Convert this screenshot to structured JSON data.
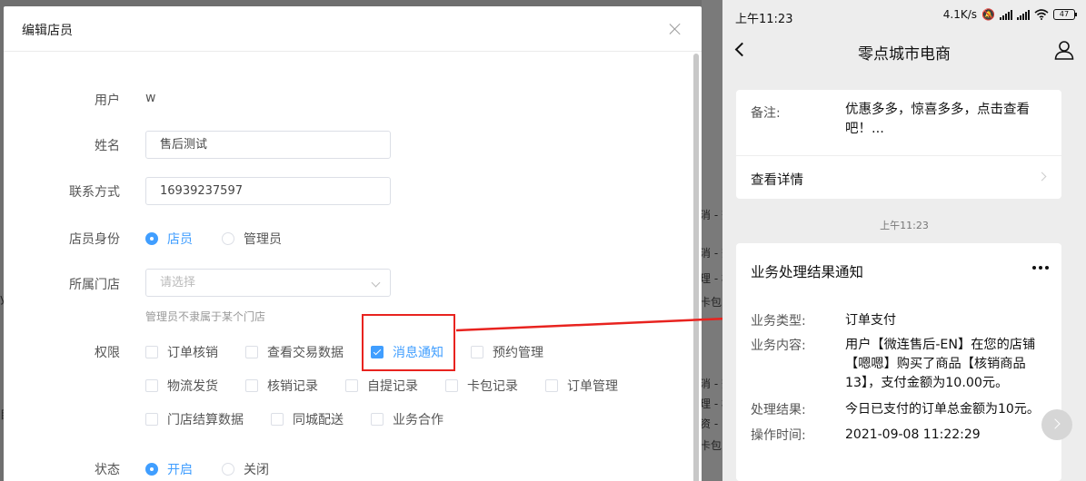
{
  "modal": {
    "title": "编辑店员",
    "fields": {
      "user_label": "用户",
      "user_value": "w",
      "name_label": "姓名",
      "name_value": "售后测试",
      "contact_label": "联系方式",
      "contact_value": "16939237597",
      "role_label": "店员身份",
      "role_options": [
        "店员",
        "管理员"
      ],
      "role_selected": "店员",
      "store_label": "所属门店",
      "store_placeholder": "请选择",
      "store_hint": "管理员不隶属于某个门店",
      "perm_label": "权限",
      "permissions": [
        {
          "label": "订单核销",
          "checked": false
        },
        {
          "label": "查看交易数据",
          "checked": false
        },
        {
          "label": "消息通知",
          "checked": true
        },
        {
          "label": "预约管理",
          "checked": false
        },
        {
          "label": "物流发货",
          "checked": false
        },
        {
          "label": "核销记录",
          "checked": false
        },
        {
          "label": "自提记录",
          "checked": false
        },
        {
          "label": "卡包记录",
          "checked": false
        },
        {
          "label": "订单管理",
          "checked": false
        },
        {
          "label": "门店结算数据",
          "checked": false
        },
        {
          "label": "同城配送",
          "checked": false
        },
        {
          "label": "业务合作",
          "checked": false
        }
      ],
      "status_label": "状态",
      "status_options": [
        "开启",
        "关闭"
      ],
      "status_selected": "开启"
    }
  },
  "background_fragments": [
    "消 - 查",
    "消 - 查",
    "理 - 核",
    "卡包",
    "消 - 查",
    "理 - 核",
    "资 - 门",
    "卡包",
    "y",
    "目"
  ],
  "phone": {
    "status_bar": {
      "time": "上午11:23",
      "speed": "4.1K/s",
      "battery": "47"
    },
    "nav_title": "零点城市电商",
    "card1": {
      "note_label": "备注:",
      "note_text": "优惠多多，惊喜多多，点击查看吧！...",
      "detail_label": "查看详情"
    },
    "timestamp": "上午11:23",
    "card2": {
      "title": "业务处理结果通知",
      "rows": [
        {
          "key": "业务类型:",
          "value": "订单支付"
        },
        {
          "key": "业务内容:",
          "value": "用户【微连售后-EN】在您的店铺【嗯嗯】购买了商品【核销商品13】，支付金额为10.00元。"
        },
        {
          "key": "处理结果:",
          "value": "今日已支付的订单总金额为10元。"
        },
        {
          "key": "操作时间:",
          "value": "2021-09-08 11:22:29"
        }
      ]
    }
  },
  "colors": {
    "accent": "#409eff",
    "highlight": "#e8231f"
  }
}
